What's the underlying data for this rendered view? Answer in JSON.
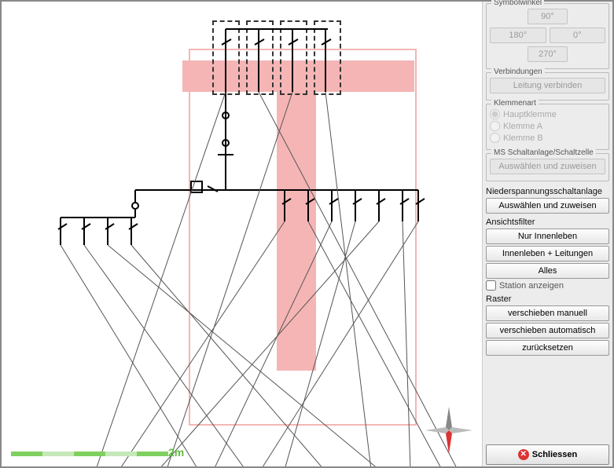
{
  "title_truncated": "",
  "scale_label": "2m",
  "sidebar": {
    "symbolwinkel": {
      "title": "Symbolwinkel",
      "b90": "90°",
      "b180": "180°",
      "b0": "0°",
      "b270": "270°"
    },
    "verbindungen": {
      "title": "Verbindungen",
      "btn": "Leitung verbinden"
    },
    "klemmenart": {
      "title": "Klemmenart",
      "haupt": "Hauptklemme",
      "a": "Klemme A",
      "b": "Klemme B"
    },
    "ms": {
      "title": "MS Schaltanlage/Schaltzelle",
      "btn": "Auswählen und zuweisen"
    },
    "ns": {
      "title": "Niederspannungsschaltanlage",
      "btn": "Auswählen und zuweisen"
    },
    "filter": {
      "title": "Ansichtsfilter",
      "b1": "Nur Innenleben",
      "b2": "Innenleben + Leitungen",
      "b3": "Alles",
      "check": "Station anzeigen"
    },
    "raster": {
      "title": "Raster",
      "b1": "verschieben manuell",
      "b2": "verschieben automatisch",
      "b3": "zurücksetzen"
    },
    "close": "Schliessen"
  }
}
